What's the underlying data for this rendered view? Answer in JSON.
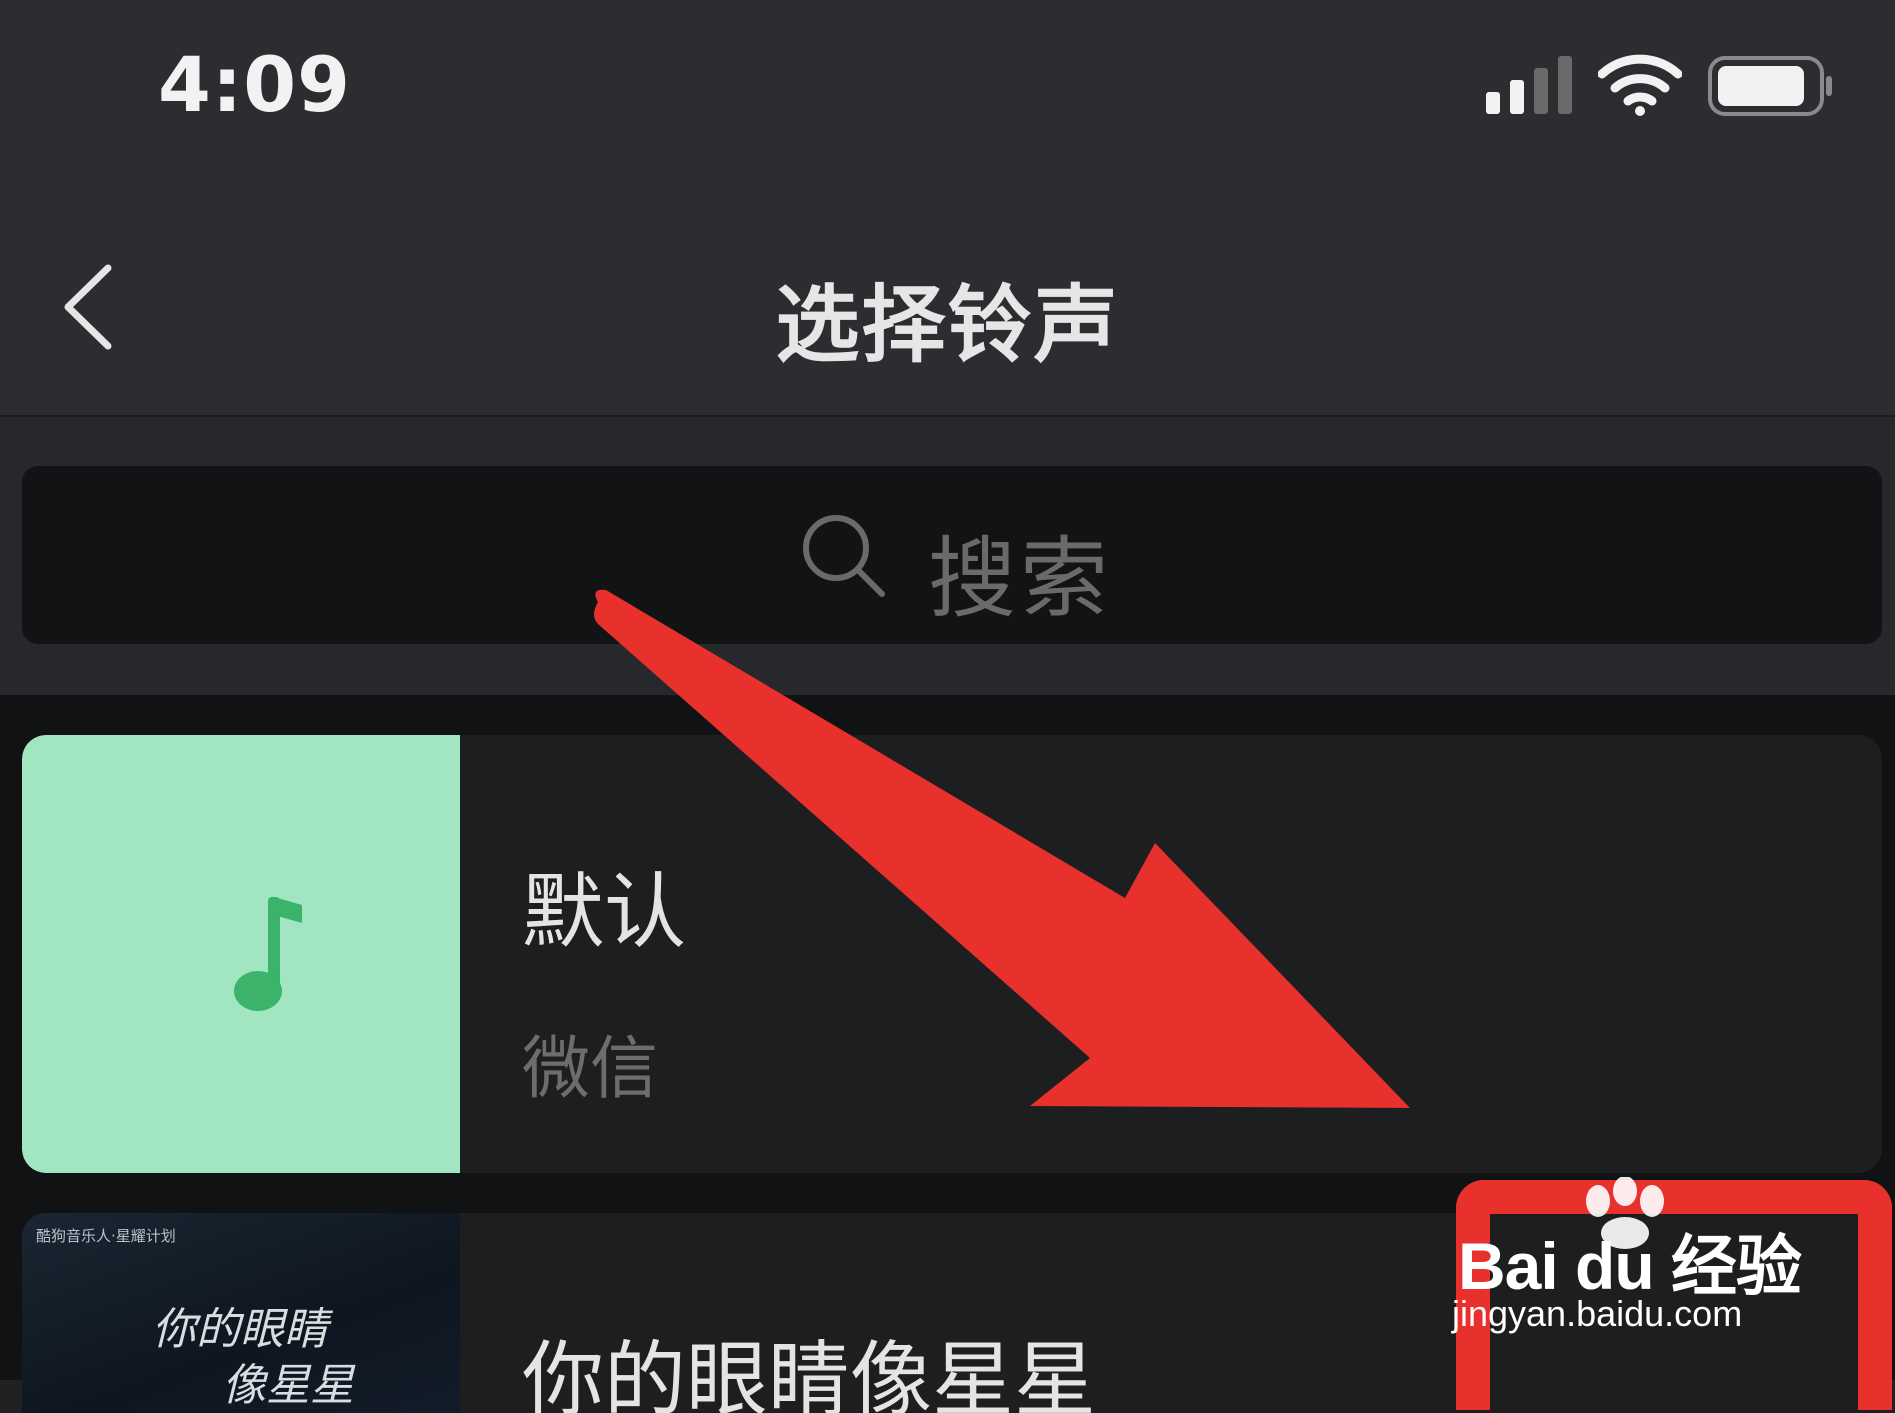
{
  "status_bar": {
    "time": "4:09",
    "icons": [
      "cellular-signal-icon",
      "wifi-icon",
      "battery-icon"
    ]
  },
  "nav": {
    "back_icon": "chevron-left-icon",
    "title": "选择铃声"
  },
  "search": {
    "icon": "search-icon",
    "placeholder": "搜索"
  },
  "ringtones": [
    {
      "title": "默认",
      "subtitle": "微信",
      "cover": "music-note-icon",
      "cover_color": "#a1e6c0"
    },
    {
      "title": "你的眼睛像星星",
      "cover_text_small": "酷狗音乐人·星耀计划",
      "cover_text_line1": "你的眼睛",
      "cover_text_line2": "像星星"
    }
  ],
  "annotation": {
    "arrow_color": "#e8302d",
    "box_color": "#e8302d"
  },
  "watermark": {
    "logo": "Bai du 经验",
    "url": "jingyan.baidu.com"
  }
}
